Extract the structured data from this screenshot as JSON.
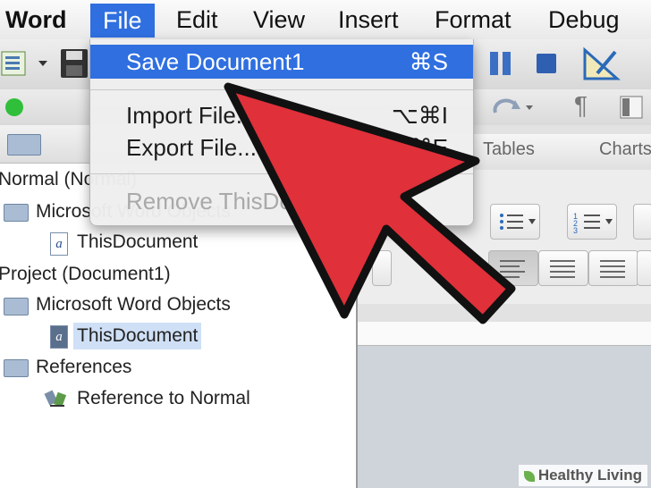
{
  "menubar": {
    "items": [
      "Word",
      "File",
      "Edit",
      "View",
      "Insert",
      "Format",
      "Debug"
    ]
  },
  "file_menu": {
    "items": [
      {
        "label": "Save Document1",
        "shortcut": "⌘S"
      },
      {
        "label": "Import File...",
        "shortcut": "⌥⌘I"
      },
      {
        "label": "Export File...",
        "shortcut": "⌥⌘E"
      },
      {
        "label": "Remove ThisDocument",
        "shortcut": ""
      }
    ]
  },
  "ribbon": {
    "tabs": [
      "Tables",
      "Charts"
    ]
  },
  "project_tree": {
    "rows": [
      "Normal (Normal)",
      "Microsoft Word Objects",
      "ThisDocument",
      "Project (Document1)",
      "Microsoft Word Objects",
      "ThisDocument",
      "References",
      "Reference to Normal"
    ]
  },
  "watermark": {
    "text": "Healthy Living"
  },
  "colors": {
    "highlight": "#2f6fe0",
    "arrow": "#e0303a",
    "selection": "#cfe0f6"
  }
}
